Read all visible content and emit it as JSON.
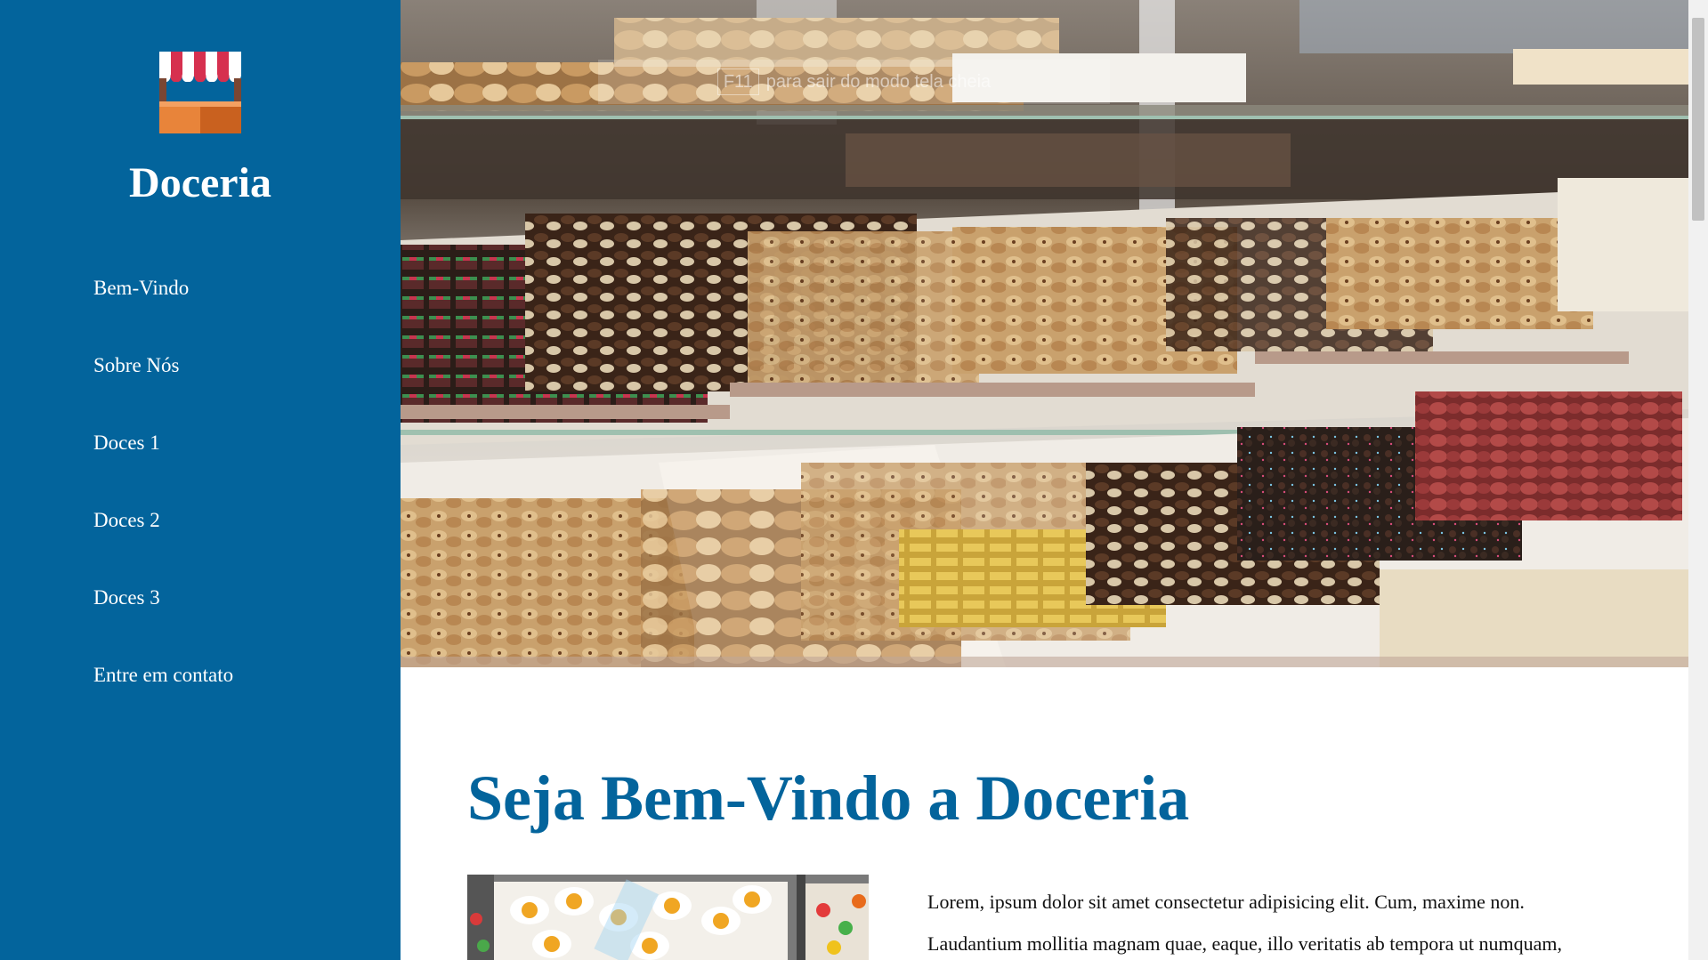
{
  "sidebar": {
    "brand": "Doceria",
    "logo_icon": "shop-stall-icon",
    "background": "#03649c",
    "nav": [
      {
        "label": "Bem-Vindo"
      },
      {
        "label": "Sobre Nós"
      },
      {
        "label": "Doces 1"
      },
      {
        "label": "Doces 2"
      },
      {
        "label": "Doces 3"
      },
      {
        "label": "Entre em contato"
      }
    ]
  },
  "hero": {
    "fullscreen_hint_key": "F11",
    "fullscreen_hint_text": "para sair do modo tela cheia"
  },
  "main": {
    "title": "Seja Bem-Vindo a Doceria",
    "title_color": "#03649c",
    "paragraph_lines": [
      "Lorem, ipsum dolor sit amet consectetur adipisicing elit. Cum, maxime non.",
      "Laudantium mollitia magnam quae, eaque, illo veritatis ab tempora ut numquam,"
    ]
  }
}
